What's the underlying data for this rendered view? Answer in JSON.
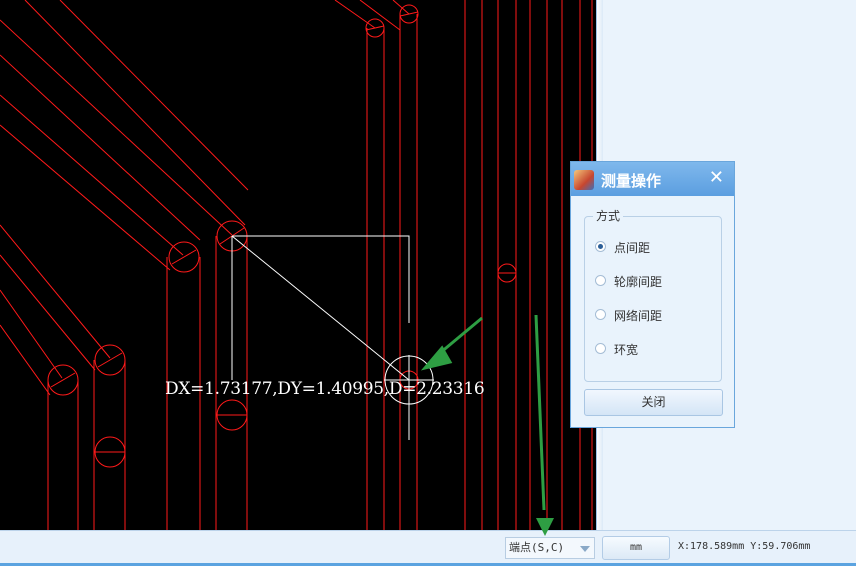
{
  "canvas": {
    "measurement_text": "DX=1.73177,DY=1.40995,D=2.23316",
    "colors": {
      "background": "#000000",
      "trace": "#ff1a1a",
      "measure_line": "#ffffff",
      "annotation_arrow": "#2e9e43"
    }
  },
  "dialog": {
    "title": "测量操作",
    "icon": "app-icon",
    "close_icon": "close-icon",
    "group_label": "方式",
    "options": [
      {
        "label": "点间距",
        "selected": true
      },
      {
        "label": "轮廓间距",
        "selected": false
      },
      {
        "label": "网络间距",
        "selected": false
      },
      {
        "label": "环宽",
        "selected": false
      }
    ],
    "close_button": "关闭"
  },
  "statusbar": {
    "snap_mode": "端点(S,C)",
    "unit": "mm",
    "coordinates": "X:178.589mm Y:59.706mm"
  }
}
